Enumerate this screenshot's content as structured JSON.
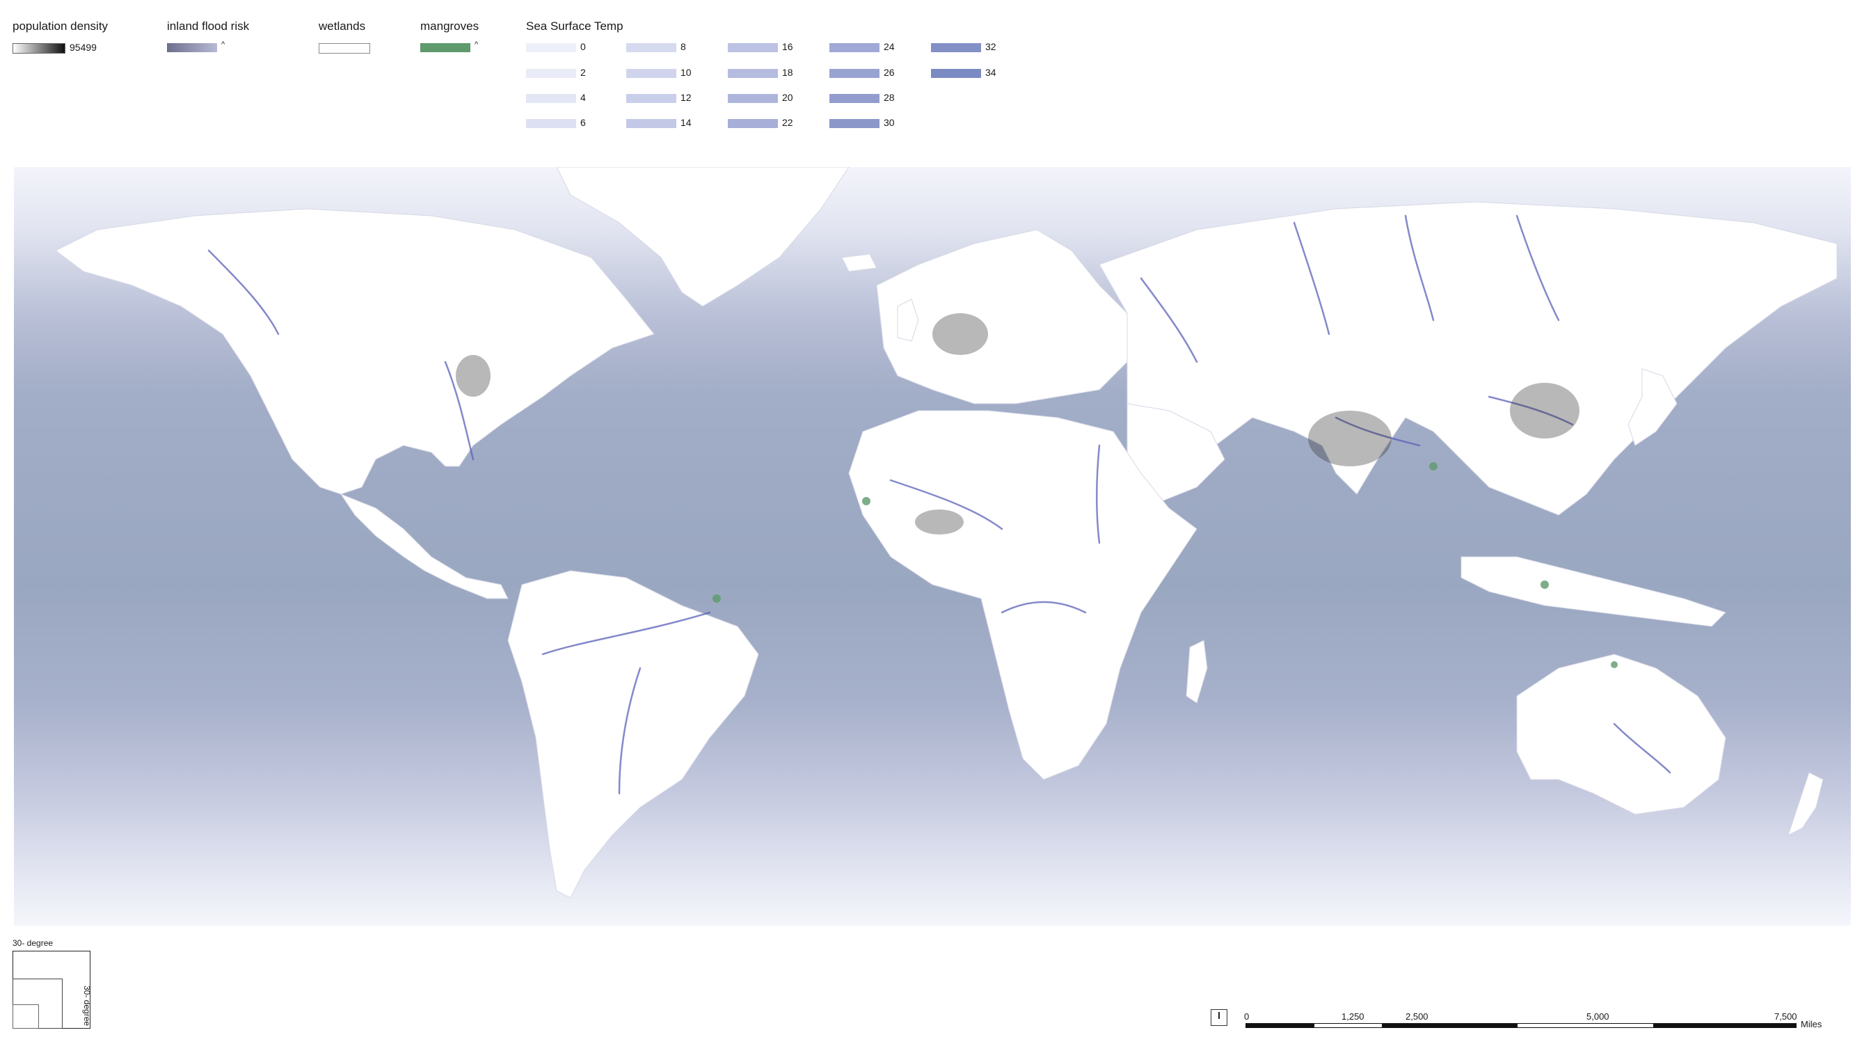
{
  "legend": {
    "population_density": {
      "title": "population density",
      "max_label": "95499"
    },
    "inland_flood_risk": {
      "title": "inland flood risk",
      "caret": "^"
    },
    "wetlands": {
      "title": "wetlands"
    },
    "mangroves": {
      "title": "mangroves",
      "caret": "^",
      "color": "#5e9a6c"
    },
    "sea_surface_temp": {
      "title": "Sea Surface Temp",
      "items": [
        {
          "label": "0",
          "color": "#eef0f9"
        },
        {
          "label": "2",
          "color": "#e9ebf7"
        },
        {
          "label": "4",
          "color": "#e3e6f4"
        },
        {
          "label": "6",
          "color": "#dde0f2"
        },
        {
          "label": "8",
          "color": "#d6daef"
        },
        {
          "label": "10",
          "color": "#d0d4ed"
        },
        {
          "label": "12",
          "color": "#c9ceea"
        },
        {
          "label": "14",
          "color": "#c3c8e7"
        },
        {
          "label": "16",
          "color": "#bcc2e3"
        },
        {
          "label": "18",
          "color": "#b5bce0"
        },
        {
          "label": "20",
          "color": "#aeb5dc"
        },
        {
          "label": "22",
          "color": "#a7afd9"
        },
        {
          "label": "24",
          "color": "#a0a9d5"
        },
        {
          "label": "26",
          "color": "#99a3d1"
        },
        {
          "label": "28",
          "color": "#929ccd"
        },
        {
          "label": "30",
          "color": "#8b96c9"
        },
        {
          "label": "32",
          "color": "#8390c6"
        },
        {
          "label": "34",
          "color": "#7b8ac2"
        }
      ]
    }
  },
  "grid": {
    "top_label": "30- degree",
    "side_label": "30- degree"
  },
  "scale_bar": {
    "ticks": [
      "0",
      "1,250",
      "2,500",
      "5,000",
      "7,500"
    ],
    "unit": "Miles"
  },
  "colors": {
    "land": "#ffffff",
    "ocean_deep": "#9ba7c2",
    "ocean_light": "#dfe2ef",
    "rivers": "#5b61b8"
  }
}
